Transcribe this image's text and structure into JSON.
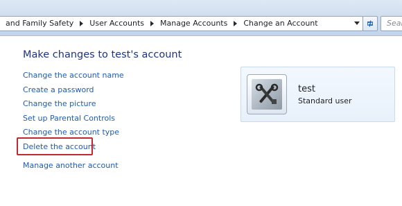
{
  "breadcrumb": {
    "items": [
      "and Family Safety",
      "User Accounts",
      "Manage Accounts",
      "Change an Account"
    ]
  },
  "search": {
    "placeholder": "Sear"
  },
  "page": {
    "heading": "Make changes to test's account"
  },
  "tasks": {
    "change_name": "Change the account name",
    "create_password": "Create a password",
    "change_picture": "Change the picture",
    "parental_controls": "Set up Parental Controls",
    "change_type": "Change the account type",
    "delete_account": "Delete the account",
    "manage_another": "Manage another account"
  },
  "account": {
    "name": "test",
    "type": "Standard user",
    "avatar_icon": "tools-icon"
  },
  "colors": {
    "link": "#1e5bb5",
    "heading": "#1e3287",
    "highlight": "#c0282d"
  }
}
